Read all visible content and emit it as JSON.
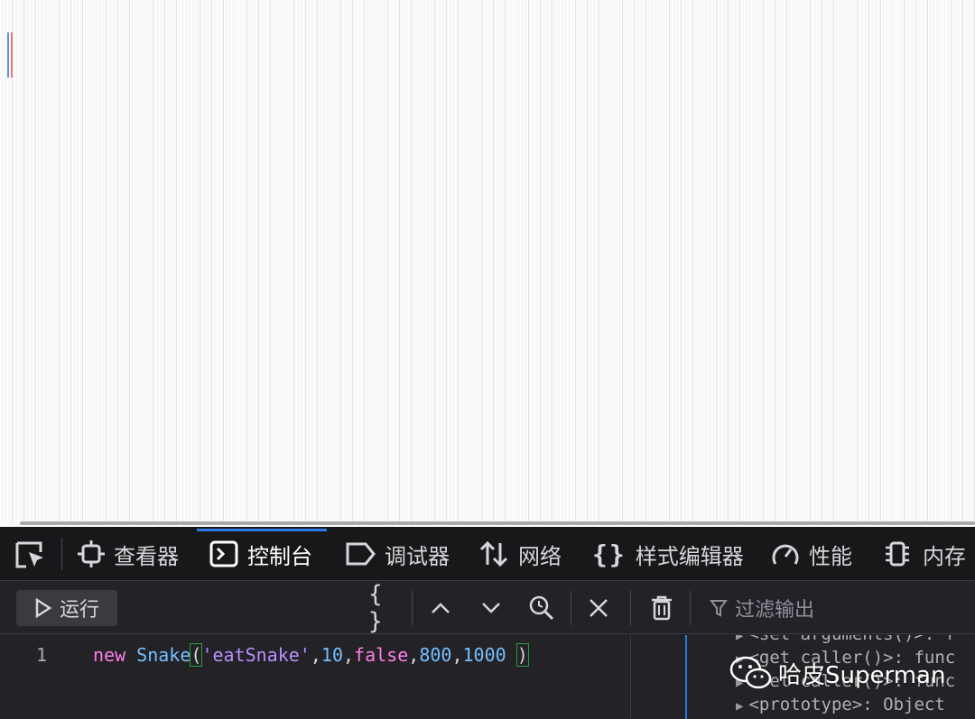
{
  "devtools": {
    "tabs": [
      {
        "label": "查看器",
        "icon": "inspector-icon"
      },
      {
        "label": "控制台",
        "icon": "console-icon",
        "active": true
      },
      {
        "label": "调试器",
        "icon": "debugger-icon"
      },
      {
        "label": "网络",
        "icon": "network-icon"
      },
      {
        "label": "样式编辑器",
        "icon": "style-editor-icon"
      },
      {
        "label": "性能",
        "icon": "performance-icon"
      },
      {
        "label": "内存",
        "icon": "memory-icon"
      }
    ],
    "toolbar": {
      "run_label": "运行",
      "pretty_print": "{ }",
      "filter_placeholder": "过滤输出"
    },
    "editor": {
      "line_number": "1",
      "code": {
        "keyword": "new",
        "class": "Snake",
        "open_paren": "(",
        "string": "'eatSnake'",
        "comma": ",",
        "arg2": "10",
        "arg3": "false",
        "arg4": "800",
        "arg5": "1000",
        "close_paren": ")"
      }
    },
    "output": {
      "lines": [
        "<set arguments()>: f",
        "<get caller()>: func",
        "<set caller()>: func",
        "<prototype>: Object"
      ]
    }
  },
  "watermark": {
    "text": "哈皮Superman",
    "icon": "wechat-icon"
  },
  "colors": {
    "devtools_bg": "#232327",
    "tabbar_bg": "#18181a",
    "accent": "#2a7ae2",
    "keyword": "#ff7de9",
    "identifier": "#75bfff",
    "string": "#b98eff"
  }
}
